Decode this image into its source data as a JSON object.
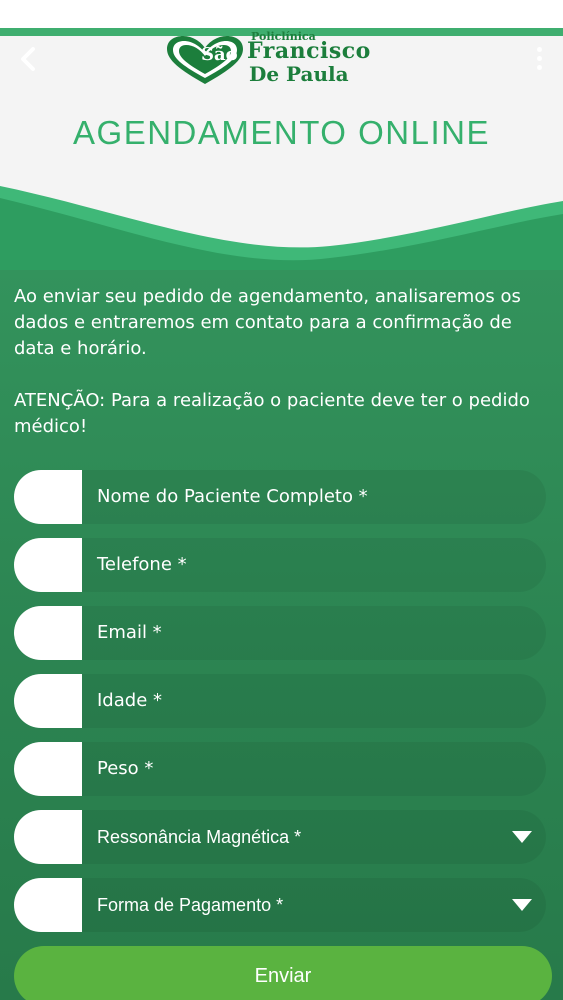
{
  "header": {
    "logo": {
      "small_text": "Policlínica",
      "sao": "São",
      "main": "Francisco",
      "sub": "De Paula",
      "icon": "heart-logo-icon"
    },
    "title": "AGENDAMENTO ONLINE",
    "back_icon": "chevron-left-icon",
    "menu_icon": "more-vertical-icon"
  },
  "content": {
    "intro": "Ao enviar seu pedido de agendamento, analisaremos os dados e entraremos em contato para a confirmação de data e horário.",
    "warning": "ATENÇÃO: Para a realização o paciente deve ter o pedido médico!"
  },
  "form": {
    "fields": [
      {
        "label": "Nome do Paciente Completo *",
        "type": "text"
      },
      {
        "label": "Telefone *",
        "type": "text"
      },
      {
        "label": "Email *",
        "type": "text"
      },
      {
        "label": "Idade *",
        "type": "text"
      },
      {
        "label": "Peso *",
        "type": "text"
      },
      {
        "label": "Ressonância Magnética *",
        "type": "select"
      },
      {
        "label": "Forma de Pagamento *",
        "type": "select"
      }
    ],
    "submit_label": "Enviar"
  },
  "colors": {
    "brand_green": "#1c7e3c",
    "title_green": "#35b06c",
    "background_green": "#2c8552",
    "button_green": "#5ab340"
  }
}
